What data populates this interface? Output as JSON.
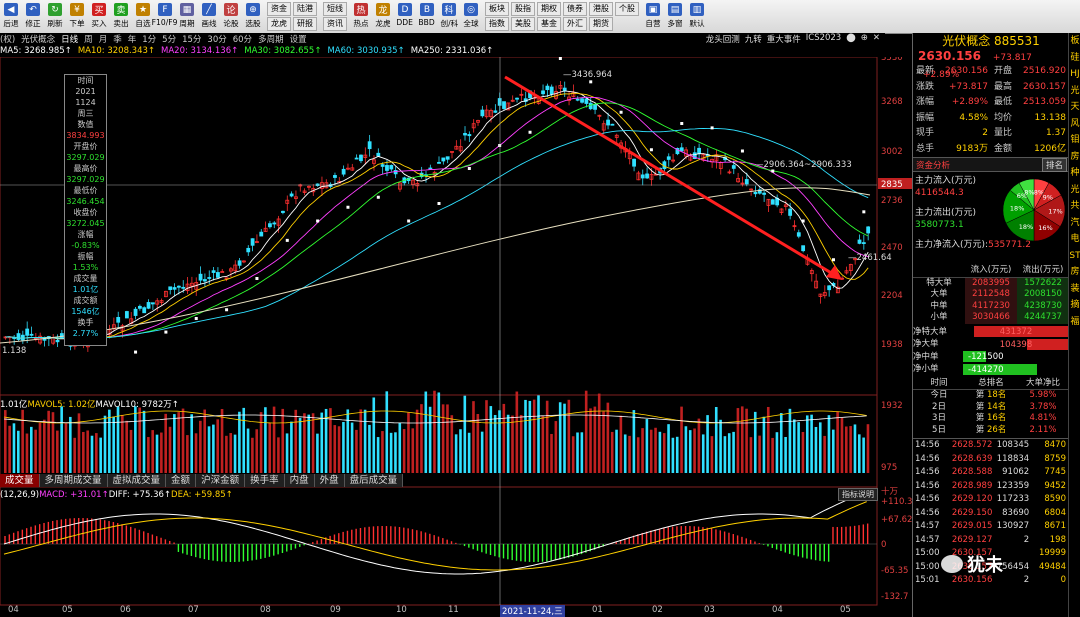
{
  "toolbar": {
    "buttons": [
      {
        "label": "后退",
        "color": "#3060c0",
        "glyph": "◀"
      },
      {
        "label": "修正",
        "color": "#3060c0",
        "glyph": "↶"
      },
      {
        "label": "刷新",
        "color": "#30a030",
        "glyph": "↻"
      },
      {
        "label": "下单",
        "color": "#c08000",
        "glyph": "¥"
      },
      {
        "label": "买入",
        "color": "#d02020",
        "glyph": "买"
      },
      {
        "label": "卖出",
        "color": "#20a020",
        "glyph": "卖"
      },
      {
        "label": "自选",
        "color": "#c08000",
        "glyph": "★"
      },
      {
        "label": "F10/F9",
        "color": "#3060c0",
        "glyph": "F"
      },
      {
        "label": "周期",
        "color": "#6060a0",
        "glyph": "▦"
      },
      {
        "label": "画线",
        "color": "#3060c0",
        "glyph": "╱"
      },
      {
        "label": "论股",
        "color": "#c04040",
        "glyph": "论"
      },
      {
        "label": "选股",
        "color": "#3060c0",
        "glyph": "⊕"
      }
    ],
    "grid1": [
      "资金",
      "陆港",
      "龙虎",
      "研报"
    ],
    "grid2": [
      "短线",
      "资讯"
    ],
    "btn2": [
      {
        "label": "热点",
        "color": "#c03030",
        "glyph": "热"
      },
      {
        "label": "龙虎",
        "color": "#c08000",
        "glyph": "龙"
      },
      {
        "label": "DDE",
        "color": "#3060c0",
        "glyph": "D"
      },
      {
        "label": "BBD",
        "color": "#3060c0",
        "glyph": "B"
      },
      {
        "label": "创/科",
        "color": "#3060c0",
        "glyph": "科"
      },
      {
        "label": "全球",
        "color": "#3060c0",
        "glyph": "◎"
      }
    ],
    "grid3": [
      "板块",
      "股指",
      "期权",
      "债券",
      "港股",
      "个股",
      "指数",
      "美股",
      "基金",
      "外汇",
      "期货"
    ],
    "btn3": [
      {
        "label": "自营",
        "color": "#3060c0",
        "glyph": "▣"
      },
      {
        "label": "多窗",
        "color": "#3060c0",
        "glyph": "▤"
      },
      {
        "label": "默认",
        "color": "#3060c0",
        "glyph": "▥"
      }
    ]
  },
  "tabbar": {
    "left": [
      "(权)",
      "光伏概念"
    ],
    "periods": [
      "日线",
      "周",
      "月",
      "季",
      "年",
      "1分",
      "5分",
      "15分",
      "30分",
      "60分",
      "多周期",
      "设置"
    ],
    "right": [
      "龙头回测",
      "九转",
      "重大事件",
      "ICS2023",
      "⬤",
      "⊕",
      "✕"
    ]
  },
  "ma_legend": [
    {
      "text": "MA5: 3268.985↑",
      "color": "#ffffff"
    },
    {
      "text": "MA10: 3208.343↑",
      "color": "#ffd000"
    },
    {
      "text": "MA20: 3134.136↑",
      "color": "#ff40ff"
    },
    {
      "text": "MA30: 3082.655↑",
      "color": "#30ff30"
    },
    {
      "text": "MA60: 3030.935↑",
      "color": "#30e0ff"
    },
    {
      "text": "MA250: 2331.036↑",
      "color": "#ffffff"
    }
  ],
  "price_axis": [
    "3530",
    "3268",
    "3002",
    "2736",
    "2470",
    "2204",
    "1938"
  ],
  "current_price_tag": "2835",
  "price_labels": {
    "high": "3436.964",
    "mid": "2906.364~2906.333",
    "low": "2461.64",
    "left": "1.138"
  },
  "infobox": {
    "rows": [
      {
        "k": "时间",
        "v": "2021",
        "cls": ""
      },
      {
        "k": "",
        "v": "1124",
        "cls": ""
      },
      {
        "k": "",
        "v": "周三",
        "cls": ""
      },
      {
        "k": "数值",
        "v": "3834.993",
        "cls": "v-red"
      },
      {
        "k": "开盘价",
        "v": "3297.029",
        "cls": "v-green"
      },
      {
        "k": "最高价",
        "v": "3297.029",
        "cls": "v-green"
      },
      {
        "k": "最低价",
        "v": "3246.454",
        "cls": "v-green"
      },
      {
        "k": "收盘价",
        "v": "3272.045",
        "cls": "v-green"
      },
      {
        "k": "涨幅",
        "v": "-0.83%",
        "cls": "v-green"
      },
      {
        "k": "振幅",
        "v": "1.53%",
        "cls": "v-green"
      },
      {
        "k": "成交量",
        "v": "1.01亿",
        "cls": "v-cyan"
      },
      {
        "k": "成交额",
        "v": "1546亿",
        "cls": "v-cyan"
      },
      {
        "k": "换手",
        "v": "2.77%",
        "cls": "v-cyan"
      }
    ]
  },
  "vol_legend": [
    {
      "text": "1.01亿",
      "color": "#ffffff"
    },
    {
      "text": "MAVOL5: 1.02亿",
      "color": "#ffd000"
    },
    {
      "text": "MAVOL10: 9782万↑",
      "color": "#ffffff"
    }
  ],
  "vol_axis": [
    "1932",
    "975",
    "十万"
  ],
  "bottom_tabs": [
    "成交量",
    "多周期成交量",
    "虚拟成交量",
    "金额",
    "沪深金额",
    "换手率",
    "内盘",
    "外盘",
    "盘后成交量"
  ],
  "macd_legend": [
    {
      "text": "(12,26,9)",
      "color": "#ffffff"
    },
    {
      "text": "MACD: +31.01↑",
      "color": "#ff40ff"
    },
    {
      "text": "DIFF: +75.36↑",
      "color": "#ffffff"
    },
    {
      "text": "DEA: +59.85↑",
      "color": "#ffd000"
    }
  ],
  "macd_btn": "指标说明",
  "macd_axis": [
    "+110.3",
    "+67.62",
    "0",
    "-65.35",
    "-132.7"
  ],
  "xaxis": [
    "04",
    "05",
    "06",
    "07",
    "08",
    "09",
    "10",
    "11",
    "2021-11-24,三",
    "01",
    "02",
    "03",
    "04",
    "05"
  ],
  "right": {
    "title": "光伏概念 885531",
    "price": "2630.156",
    "change": "+73.817",
    "pct": "+2.89%",
    "quote": [
      [
        {
          "k": "最新",
          "v": "2630.156",
          "c": "red"
        },
        {
          "k": "开盘",
          "v": "2516.920",
          "c": "red"
        }
      ],
      [
        {
          "k": "涨跌",
          "v": "+73.817",
          "c": "red"
        },
        {
          "k": "最高",
          "v": "2630.157",
          "c": "red"
        }
      ],
      [
        {
          "k": "涨幅",
          "v": "+2.89%",
          "c": "red"
        },
        {
          "k": "最低",
          "v": "2513.059",
          "c": "red"
        }
      ],
      [
        {
          "k": "振幅",
          "v": "4.58%",
          "c": "yellow"
        },
        {
          "k": "均价",
          "v": "13.138",
          "c": "yellow"
        }
      ],
      [
        {
          "k": "现手",
          "v": "2",
          "c": "yellow"
        },
        {
          "k": "量比",
          "v": "1.37",
          "c": "yellow"
        }
      ],
      [
        {
          "k": "总手",
          "v": "9183万",
          "c": "yellow"
        },
        {
          "k": "金额",
          "v": "1206亿",
          "c": "yellow"
        }
      ]
    ],
    "fund_header": "资金分析",
    "rank_btn": "排名",
    "main_in_label": "主力流入(万元)",
    "main_in": "4116544.3",
    "main_out_label": "主力流出(万元)",
    "main_out": "3580773.1",
    "net_label": "主力净流入(万元):",
    "net": "535771.2",
    "pie": [
      {
        "pct": 8,
        "color": "#ff4040",
        "label": "8%"
      },
      {
        "pct": 9,
        "color": "#d02020",
        "label": "9%"
      },
      {
        "pct": 17,
        "color": "#b01818",
        "label": "17%"
      },
      {
        "pct": 16,
        "color": "#900000",
        "label": "16%"
      },
      {
        "pct": 18,
        "color": "#008000",
        "label": "18%"
      },
      {
        "pct": 18,
        "color": "#00a000",
        "label": "18%"
      },
      {
        "pct": 6,
        "color": "#20c020",
        "label": "6%"
      },
      {
        "pct": 8,
        "color": "#40e040",
        "label": "8%"
      }
    ],
    "flow_header": [
      "",
      "流入(万元)",
      "流出(万元)"
    ],
    "flow": [
      {
        "k": "特大单",
        "in": "2083995",
        "out": "1572622"
      },
      {
        "k": "大单",
        "in": "2112548",
        "out": "2008150"
      },
      {
        "k": "中单",
        "in": "4117230",
        "out": "4238730"
      },
      {
        "k": "小单",
        "in": "3030466",
        "out": "4244737"
      }
    ],
    "net_rows": [
      {
        "k": "净特大单",
        "v": "431372",
        "pos": true,
        "frac": 0.9
      },
      {
        "k": "净大单",
        "v": "104398",
        "pos": true,
        "frac": 0.4
      },
      {
        "k": "净中单",
        "v": "-121500",
        "pos": false,
        "frac": 0.22
      },
      {
        "k": "净小单",
        "v": "-414270",
        "pos": false,
        "frac": 0.7
      }
    ],
    "rank_header": [
      "时间",
      "总排名",
      "大单净比"
    ],
    "rank": [
      {
        "t": "今日",
        "a": "第",
        "n": "18名",
        "p": "5.98%"
      },
      {
        "t": "2日",
        "a": "第",
        "n": "14名",
        "p": "3.78%"
      },
      {
        "t": "3日",
        "a": "第",
        "n": "16名",
        "p": "4.81%"
      },
      {
        "t": "5日",
        "a": "第",
        "n": "26名",
        "p": "2.11%"
      }
    ],
    "ticks": [
      {
        "t": "14:56",
        "p": "2628.572",
        "v": "108345",
        "n": "8470"
      },
      {
        "t": "14:56",
        "p": "2628.639",
        "v": "118834",
        "n": "8759"
      },
      {
        "t": "14:56",
        "p": "2628.588",
        "v": "91062",
        "n": "7745"
      },
      {
        "t": "14:56",
        "p": "2628.989",
        "v": "123359",
        "n": "9452"
      },
      {
        "t": "14:56",
        "p": "2629.120",
        "v": "117233",
        "n": "8590"
      },
      {
        "t": "14:56",
        "p": "2629.150",
        "v": "83690",
        "n": "6804"
      },
      {
        "t": "14:57",
        "p": "2629.015",
        "v": "130927",
        "n": "8671"
      },
      {
        "t": "14:57",
        "p": "2629.127",
        "v": "2",
        "n": "198"
      },
      {
        "t": "15:00",
        "p": "2630.157",
        "v": "",
        "n": "19999"
      },
      {
        "t": "15:00",
        "p": "2630.157",
        "v": "756454",
        "n": "49484"
      },
      {
        "t": "15:01",
        "p": "2630.156",
        "v": "2",
        "n": "0"
      }
    ],
    "watermark": "犹未"
  },
  "farright": [
    "板",
    "硅",
    "HJ",
    "光",
    "天",
    "风",
    "钼",
    "房",
    "种",
    "光",
    "共",
    "汽",
    "电",
    "ST",
    "房",
    "装",
    "摘",
    "福"
  ]
}
